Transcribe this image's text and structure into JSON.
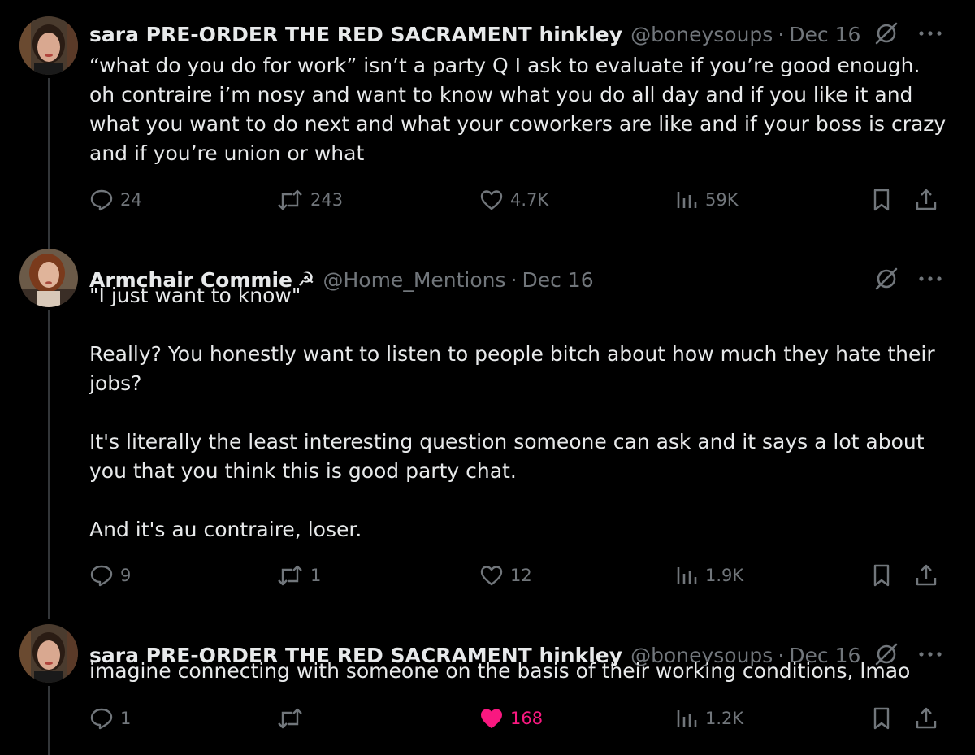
{
  "tweets": [
    {
      "display_name": "sara PRE-ORDER THE RED SACRAMENT hinkley",
      "badge": "",
      "handle": "@boneysoups",
      "separator": "·",
      "date": "Dec 16",
      "text": "“what do you do for work” isn’t a party  Q I ask to evaluate if you’re good enough. oh contraire i’m nosy and want to know what you do all day and if you like it and what you want to do next and what your coworkers are like and if your boss is crazy and if you’re union or what",
      "replies": "24",
      "reposts": "243",
      "likes": "4.7K",
      "views": "59K",
      "liked": false,
      "avatar_colors": {
        "bg": "#4a3b2e",
        "hair": "#2a1c14",
        "face": "#d9a890",
        "lips": "#b0443c"
      }
    },
    {
      "display_name": "Armchair Commie",
      "badge": "☭",
      "handle": "@Home_Mentions",
      "separator": "·",
      "date": "Dec 16",
      "text": "\"I just want to know\"\n\nReally? You honestly want to listen to people bitch about how much they hate their jobs?\n\nIt's literally the least interesting question someone can ask and it says a lot about you that you think this is good party chat.\n\nAnd it's au contraire, loser.",
      "replies": "9",
      "reposts": "1",
      "likes": "12",
      "views": "1.9K",
      "liked": false,
      "avatar_colors": {
        "bg": "#6b5a48",
        "hair": "#7a3a1c",
        "face": "#e0b49a",
        "lips": "#a84a3c"
      }
    },
    {
      "display_name": "sara PRE-ORDER THE RED SACRAMENT hinkley",
      "badge": "",
      "handle": "@boneysoups",
      "separator": "·",
      "date": "Dec 16",
      "text": "imagine connecting with someone on the basis of their working conditions, lmao",
      "replies": "1",
      "reposts": "",
      "likes": "168",
      "views": "1.2K",
      "liked": true,
      "avatar_colors": {
        "bg": "#4a3b2e",
        "hair": "#2a1c14",
        "face": "#d9a890",
        "lips": "#b0443c"
      }
    }
  ],
  "colors": {
    "background": "#000000",
    "text": "#e7e9ea",
    "muted": "#71767b",
    "like_active": "#f91880",
    "thread_line": "#333639"
  },
  "icons": {
    "reply": "reply-bubble-icon",
    "repost": "repost-icon",
    "like": "heart-icon",
    "views": "views-bar-chart-icon",
    "bookmark": "bookmark-icon",
    "share": "share-upload-icon",
    "grok": "grok-slash-icon",
    "more": "more-dots-icon"
  }
}
